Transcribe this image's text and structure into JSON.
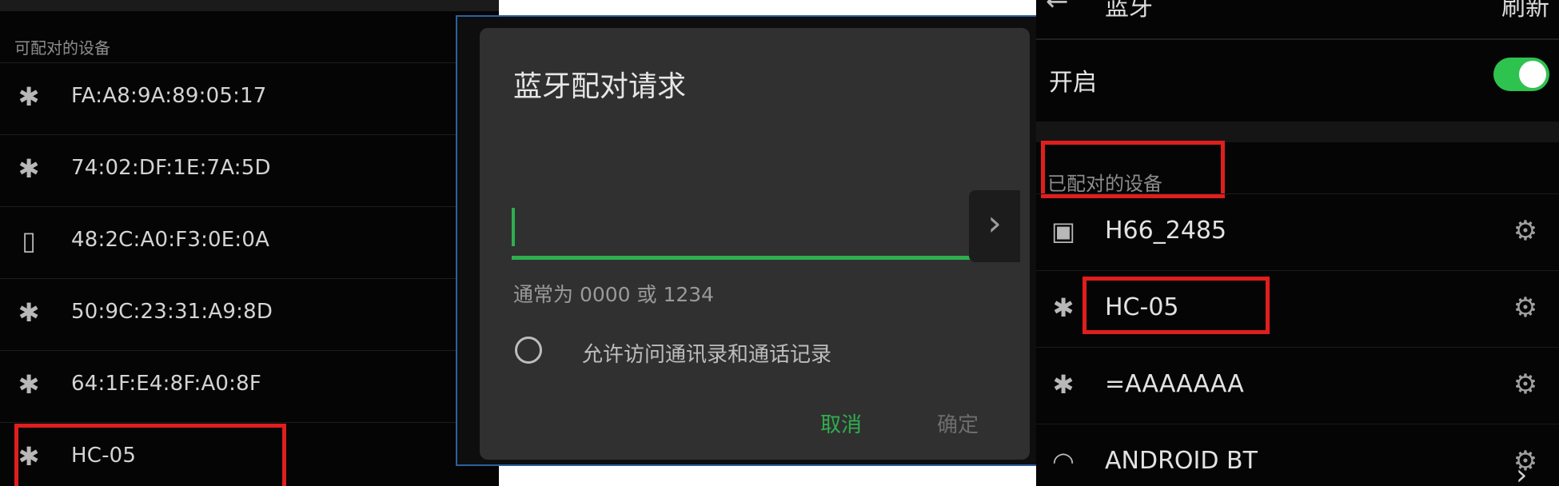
{
  "left": {
    "section_label": "可配对的设备",
    "devices": [
      {
        "icon": "bluetooth-icon",
        "label": "FA:A8:9A:89:05:17"
      },
      {
        "icon": "bluetooth-icon",
        "label": "74:02:DF:1E:7A:5D"
      },
      {
        "icon": "phone-icon",
        "label": "48:2C:A0:F3:0E:0A"
      },
      {
        "icon": "bluetooth-icon",
        "label": "50:9C:23:31:A9:8D"
      },
      {
        "icon": "bluetooth-icon",
        "label": "64:1F:E4:8F:A0:8F"
      },
      {
        "icon": "bluetooth-icon",
        "label": "HC-05"
      }
    ]
  },
  "dialog": {
    "title": "蓝牙配对请求",
    "pin_value": "",
    "hint": "通常为 0000 或 1234",
    "checkbox_label": "允许访问通讯录和通话记录",
    "cancel_label": "取消",
    "ok_label": "确定",
    "arrow_icon": "chevron-right-icon"
  },
  "right": {
    "back_icon": "back-arrow-icon",
    "title": "蓝牙",
    "refresh_label": "刷新",
    "toggle_label": "开启",
    "toggle_on": true,
    "section_label": "已配对的设备",
    "paired": [
      {
        "icon": "image-icon",
        "label": "H66_2485",
        "settings_icon": "gear-icon"
      },
      {
        "icon": "bluetooth-icon",
        "label": "HC-05",
        "settings_icon": "gear-icon"
      },
      {
        "icon": "bluetooth-icon",
        "label": "=AAAAAAA",
        "settings_icon": "gear-icon"
      },
      {
        "icon": "headphones-icon",
        "label": "ANDROID BT",
        "settings_icon": "gear-icon"
      }
    ]
  },
  "colors": {
    "accent_green": "#2fae4f",
    "highlight_red": "#e01e1e",
    "toggle_green": "#2ec24f"
  }
}
